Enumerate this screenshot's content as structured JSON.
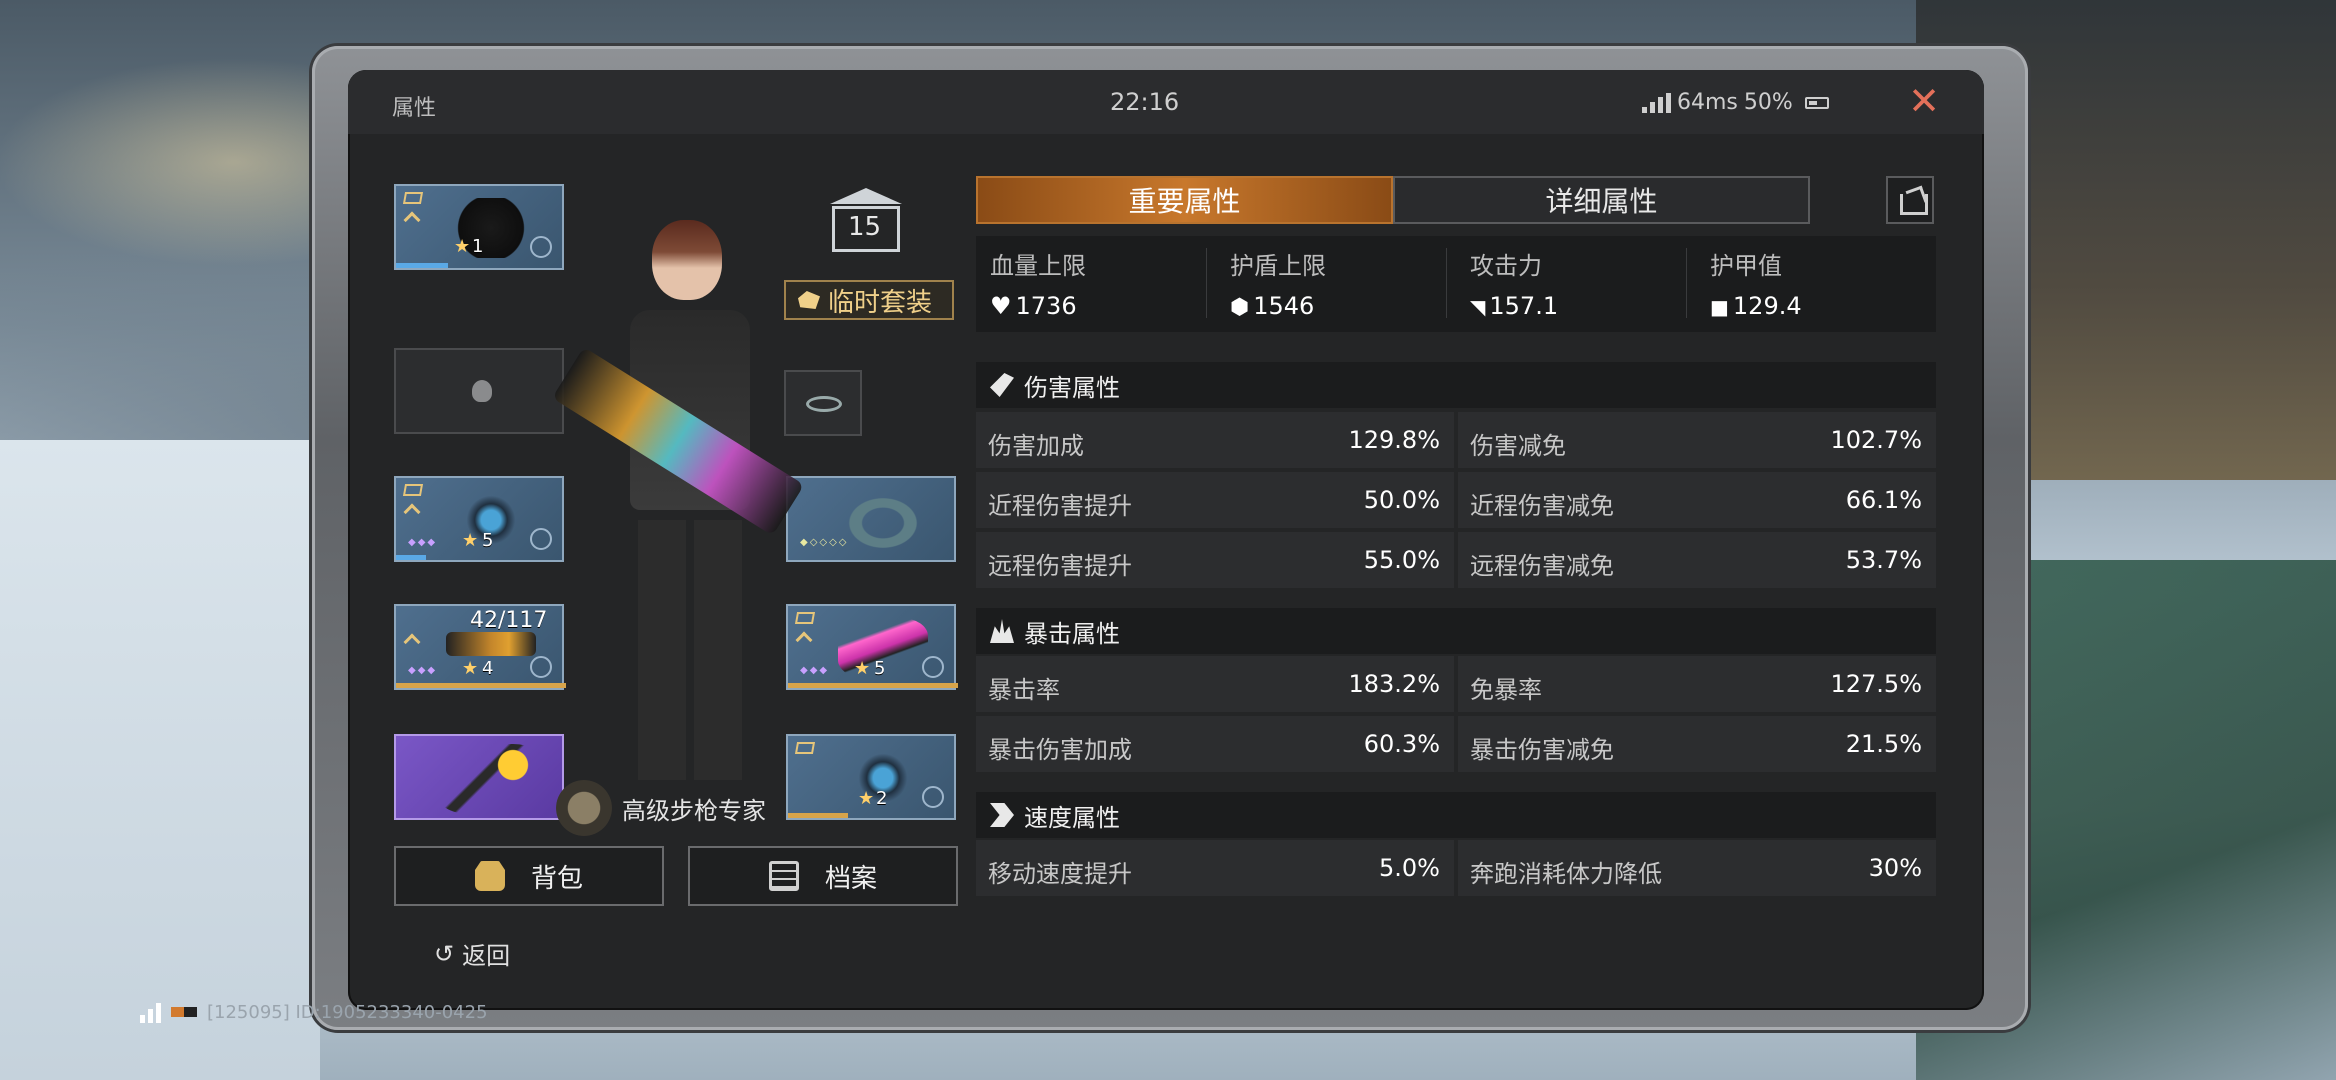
{
  "window": {
    "title": "属性",
    "time": "22:16",
    "ping": "64ms",
    "battery": "50%"
  },
  "left": {
    "suit_tag": "临时套装",
    "level": "15",
    "title_badge": "高级步枪专家",
    "ammo": "42/117",
    "slots": [
      {
        "name": "helmet",
        "level": "1"
      },
      {
        "name": "empty-slot",
        "level": ""
      },
      {
        "name": "armor",
        "level": "5"
      },
      {
        "name": "rifle",
        "level": "4"
      },
      {
        "name": "candy-wand",
        "level": ""
      },
      {
        "name": "bracelet",
        "level": ""
      },
      {
        "name": "blade",
        "level": "5"
      },
      {
        "name": "spike-gear",
        "level": "2"
      }
    ],
    "buttons": {
      "bag": "背包",
      "archive": "档案"
    },
    "back": "返回"
  },
  "footer": {
    "info": "[125095] ID:1905233340-0425"
  },
  "stats": {
    "tabs": [
      "重要属性",
      "详细属性"
    ],
    "primary": [
      {
        "label": "血量上限",
        "value": "1736",
        "icon": "heart-icon"
      },
      {
        "label": "护盾上限",
        "value": "1546",
        "icon": "shield-icon"
      },
      {
        "label": "攻击力",
        "value": "157.1",
        "icon": "pistol-icon"
      },
      {
        "label": "护甲值",
        "value": "129.4",
        "icon": "armor-icon"
      }
    ],
    "sections": [
      {
        "title": "伤害属性",
        "rows": [
          [
            "伤害加成",
            "129.8%",
            "伤害减免",
            "102.7%"
          ],
          [
            "近程伤害提升",
            "50.0%",
            "近程伤害减免",
            "66.1%"
          ],
          [
            "远程伤害提升",
            "55.0%",
            "远程伤害减免",
            "53.7%"
          ]
        ]
      },
      {
        "title": "暴击属性",
        "rows": [
          [
            "暴击率",
            "183.2%",
            "免暴率",
            "127.5%"
          ],
          [
            "暴击伤害加成",
            "60.3%",
            "暴击伤害减免",
            "21.5%"
          ]
        ]
      },
      {
        "title": "速度属性",
        "rows": [
          [
            "移动速度提升",
            "5.0%",
            "奔跑消耗体力降低",
            "30%"
          ]
        ]
      }
    ]
  },
  "colors": {
    "accent": "#c8782c",
    "close": "#e3705a",
    "panel": "#242526"
  }
}
